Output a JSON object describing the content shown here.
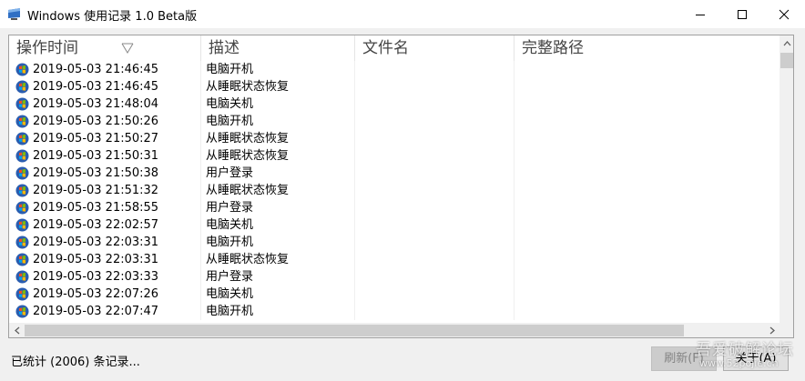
{
  "window": {
    "title": "Windows 使用记录 1.0 Beta版"
  },
  "columns": [
    "操作时间",
    "描述",
    "文件名",
    "完整路径"
  ],
  "rows": [
    {
      "time": "2019-05-03  21:46:45",
      "desc": "电脑开机",
      "file": "",
      "path": ""
    },
    {
      "time": "2019-05-03  21:46:45",
      "desc": "从睡眠状态恢复",
      "file": "",
      "path": ""
    },
    {
      "time": "2019-05-03  21:48:04",
      "desc": "电脑关机",
      "file": "",
      "path": ""
    },
    {
      "time": "2019-05-03  21:50:26",
      "desc": "电脑开机",
      "file": "",
      "path": ""
    },
    {
      "time": "2019-05-03  21:50:27",
      "desc": "从睡眠状态恢复",
      "file": "",
      "path": ""
    },
    {
      "time": "2019-05-03  21:50:31",
      "desc": "从睡眠状态恢复",
      "file": "",
      "path": ""
    },
    {
      "time": "2019-05-03  21:50:38",
      "desc": "用户登录",
      "file": "",
      "path": ""
    },
    {
      "time": "2019-05-03  21:51:32",
      "desc": "从睡眠状态恢复",
      "file": "",
      "path": ""
    },
    {
      "time": "2019-05-03  21:58:55",
      "desc": "用户登录",
      "file": "",
      "path": ""
    },
    {
      "time": "2019-05-03  22:02:57",
      "desc": "电脑关机",
      "file": "",
      "path": ""
    },
    {
      "time": "2019-05-03  22:03:31",
      "desc": "电脑开机",
      "file": "",
      "path": ""
    },
    {
      "time": "2019-05-03  22:03:31",
      "desc": "从睡眠状态恢复",
      "file": "",
      "path": ""
    },
    {
      "time": "2019-05-03  22:03:33",
      "desc": "用户登录",
      "file": "",
      "path": ""
    },
    {
      "time": "2019-05-03  22:07:26",
      "desc": "电脑关机",
      "file": "",
      "path": ""
    },
    {
      "time": "2019-05-03  22:07:47",
      "desc": "电脑开机",
      "file": "",
      "path": ""
    }
  ],
  "status_text": "已统计 (2006) 条记录...",
  "buttons": {
    "refresh": "刷新(F)",
    "about": "关于(A)"
  },
  "watermark": {
    "line1": "吾爱破解论坛",
    "line2": "www.52pojie.cn"
  },
  "colors": {
    "titlebar": "#ffffff",
    "window_bg": "#f0f0f0",
    "list_bg": "#ffffff"
  }
}
